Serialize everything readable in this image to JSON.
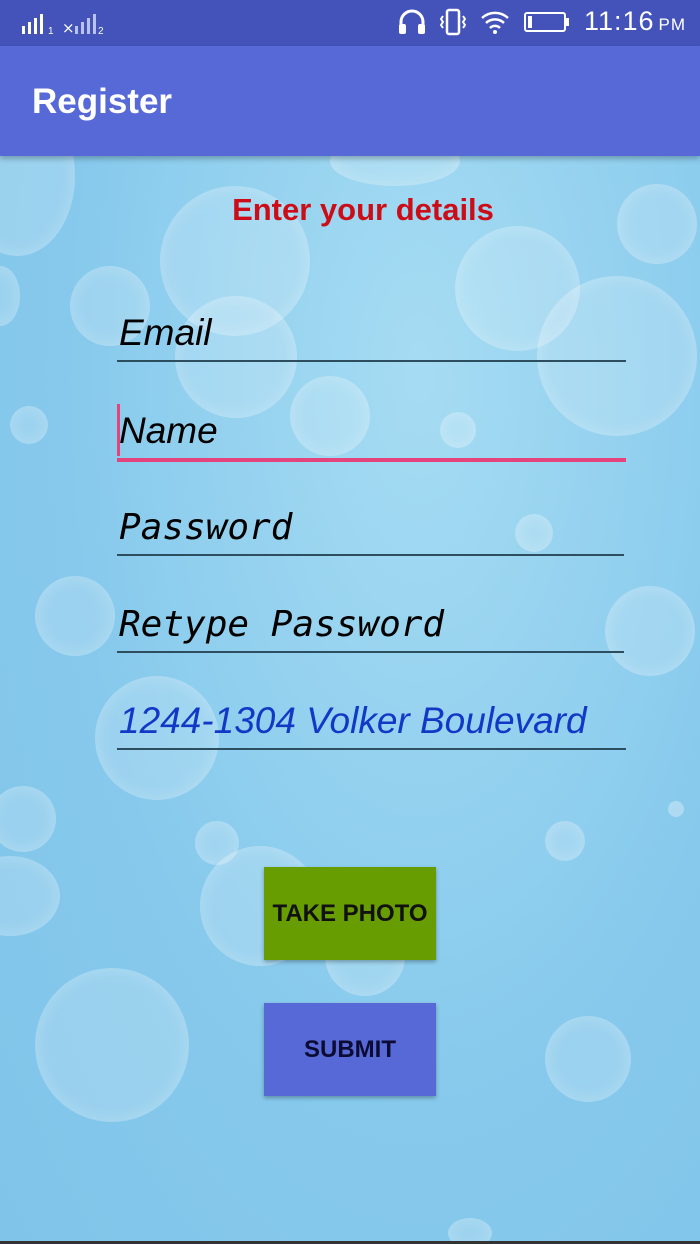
{
  "status_bar": {
    "time": "11:16",
    "ampm": "PM",
    "sim1_label": "1",
    "sim2_label": "2",
    "icons": [
      "signal-icon",
      "signal-icon",
      "headphones-icon",
      "vibrate-icon",
      "wifi-icon",
      "battery-icon"
    ]
  },
  "app_bar": {
    "title": "Register"
  },
  "form": {
    "heading": "Enter your details",
    "email": {
      "value": "Email"
    },
    "name": {
      "value": "Name"
    },
    "password": {
      "value": "Password"
    },
    "retype_password": {
      "value": "Retype Password"
    },
    "address": {
      "value": "1244-1304 Volker Boulevard"
    }
  },
  "buttons": {
    "take_photo": "TAKE PHOTO",
    "submit": "SUBMIT"
  },
  "colors": {
    "status_bar": "#4353b9",
    "app_bar": "#5669d6",
    "heading": "#cc0d17",
    "focus_accent": "#e5437b",
    "take_photo_button": "#679d00",
    "submit_button": "#5669d6",
    "address_text": "#1238c6"
  }
}
